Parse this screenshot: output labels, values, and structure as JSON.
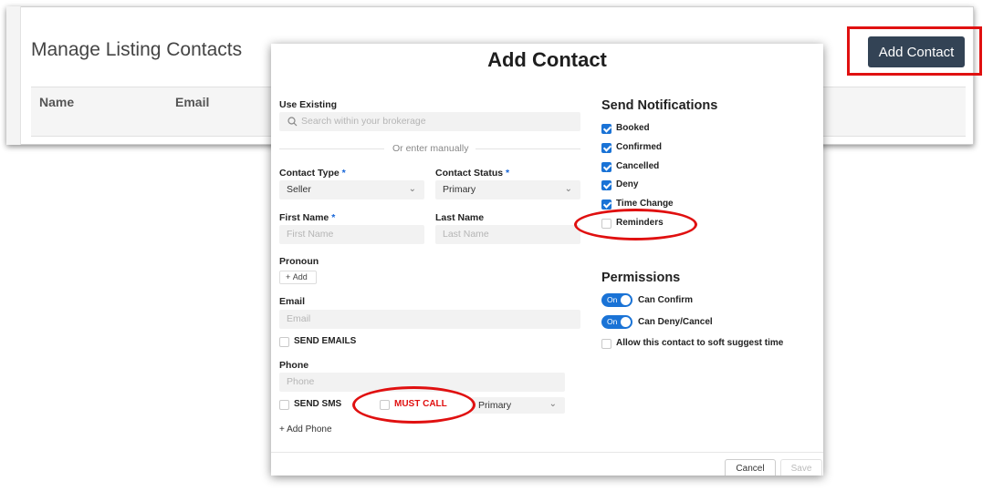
{
  "page": {
    "title": "Manage Listing Contacts",
    "columns": [
      "Name",
      "Email"
    ],
    "add_contact_button": "Add Contact"
  },
  "modal": {
    "title": "Add Contact",
    "use_existing": {
      "label": "Use Existing",
      "placeholder": "Search within your brokerage"
    },
    "or_text": "Or enter manually",
    "contact_type": {
      "label": "Contact Type",
      "required": "*",
      "value": "Seller"
    },
    "contact_status": {
      "label": "Contact Status",
      "required": "*",
      "value": "Primary"
    },
    "first_name": {
      "label": "First Name",
      "required": "*",
      "placeholder": "First Name"
    },
    "last_name": {
      "label": "Last Name",
      "placeholder": "Last Name"
    },
    "pronoun": {
      "label": "Pronoun",
      "add_label": "Add"
    },
    "email": {
      "label": "Email",
      "placeholder": "Email",
      "send_emails": "SEND EMAILS"
    },
    "phone": {
      "label": "Phone",
      "placeholder": "Phone",
      "send_sms": "SEND SMS",
      "must_call": "MUST CALL",
      "type_value": "Primary",
      "add_phone": "+ Add Phone"
    },
    "notifications": {
      "title": "Send Notifications",
      "items": [
        {
          "label": "Booked",
          "checked": true
        },
        {
          "label": "Confirmed",
          "checked": true
        },
        {
          "label": "Cancelled",
          "checked": true
        },
        {
          "label": "Deny",
          "checked": true
        },
        {
          "label": "Time Change",
          "checked": true
        },
        {
          "label": "Reminders",
          "checked": false
        }
      ]
    },
    "permissions": {
      "title": "Permissions",
      "toggle_on_text": "On",
      "can_confirm": "Can Confirm",
      "can_deny_cancel": "Can Deny/Cancel",
      "soft_suggest": "Allow this contact to soft suggest time"
    },
    "buttons": {
      "cancel": "Cancel",
      "save": "Save"
    }
  },
  "colors": {
    "accent": "#1a73d6",
    "annotation": "#e01010",
    "primary_button": "#334355"
  }
}
